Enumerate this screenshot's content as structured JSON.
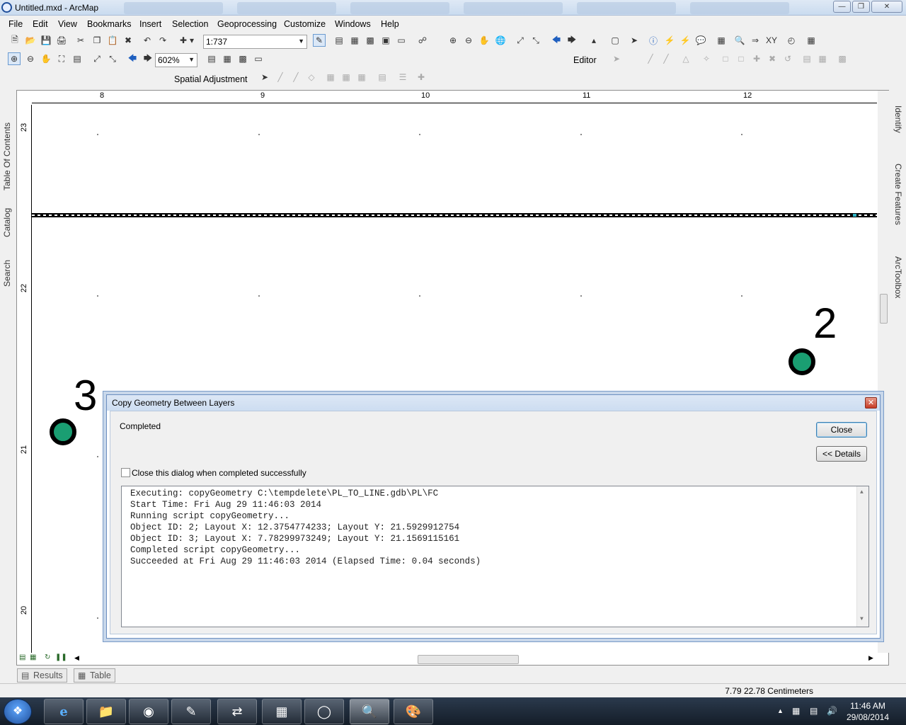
{
  "window": {
    "title": "Untitled.mxd - ArcMap"
  },
  "menu": [
    "File",
    "Edit",
    "View",
    "Bookmarks",
    "Insert",
    "Selection",
    "Geoprocessing",
    "Customize",
    "Windows",
    "Help"
  ],
  "toolbar": {
    "scale_value": "1:737",
    "zoom_value": "602%",
    "editor_label": "Editor",
    "spatial_adjustment_label": "Spatial Adjustment"
  },
  "left_dock": [
    "Table Of Contents",
    "Catalog",
    "Search"
  ],
  "right_dock": [
    "Identify",
    "Create Features",
    "ArcToolbox"
  ],
  "ruler": {
    "x_labels": [
      "8",
      "9",
      "10",
      "11",
      "12"
    ],
    "y_labels": [
      "23",
      "22",
      "21",
      "20"
    ]
  },
  "map": {
    "point_labels": [
      "2",
      "3"
    ],
    "point_color": "#1a9e72"
  },
  "dialog": {
    "title": "Copy Geometry Between Layers",
    "status": "Completed",
    "close_button": "Close",
    "details_button": "<< Details",
    "checkbox_label": "Close this dialog when completed successfully",
    "checkbox_checked": false,
    "log_lines": [
      "Executing: copyGeometry C:\\tempdelete\\PL_TO_LINE.gdb\\PL\\FC",
      "Start Time: Fri Aug 29 11:46:03 2014",
      "Running script copyGeometry...",
      "Object ID: 2; Layout X: 12.3754774233; Layout Y: 21.5929912754",
      "Object ID: 3; Layout X: 7.78299973249; Layout Y: 21.1569115161",
      "Completed script copyGeometry...",
      "Succeeded at Fri Aug 29 11:46:03 2014 (Elapsed Time: 0.04 seconds)"
    ]
  },
  "bottom_tabs": [
    "Results",
    "Table"
  ],
  "status": {
    "coordinates": "7.79  22.78 Centimeters"
  },
  "taskbar": {
    "time": "11:46 AM",
    "date": "29/08/2014"
  }
}
